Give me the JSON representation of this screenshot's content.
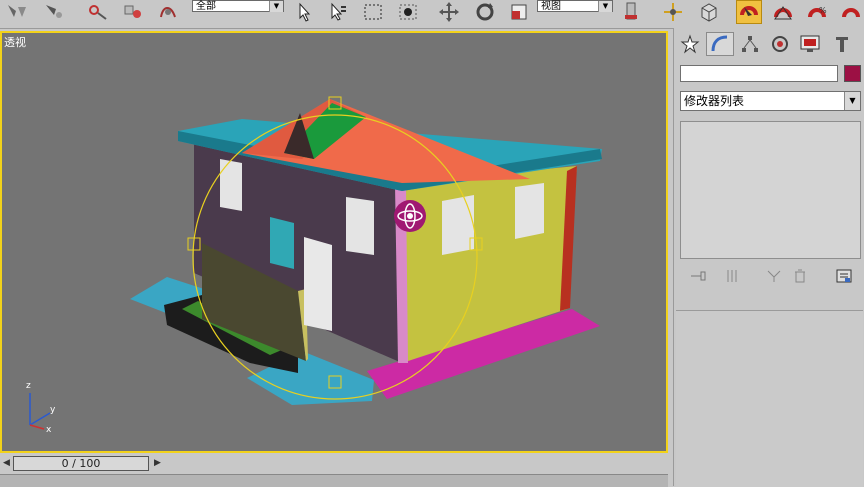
{
  "toolbar": {
    "selection_filter": "全部",
    "reference_coord": "视图"
  },
  "viewport": {
    "label": "透视",
    "axes": {
      "x": "x",
      "y": "y",
      "z": "z"
    }
  },
  "command_panel": {
    "object_name": "",
    "object_color": "#9c1044",
    "modifier_list": "修改器列表"
  },
  "timeline": {
    "slider_text": "0 / 100"
  }
}
